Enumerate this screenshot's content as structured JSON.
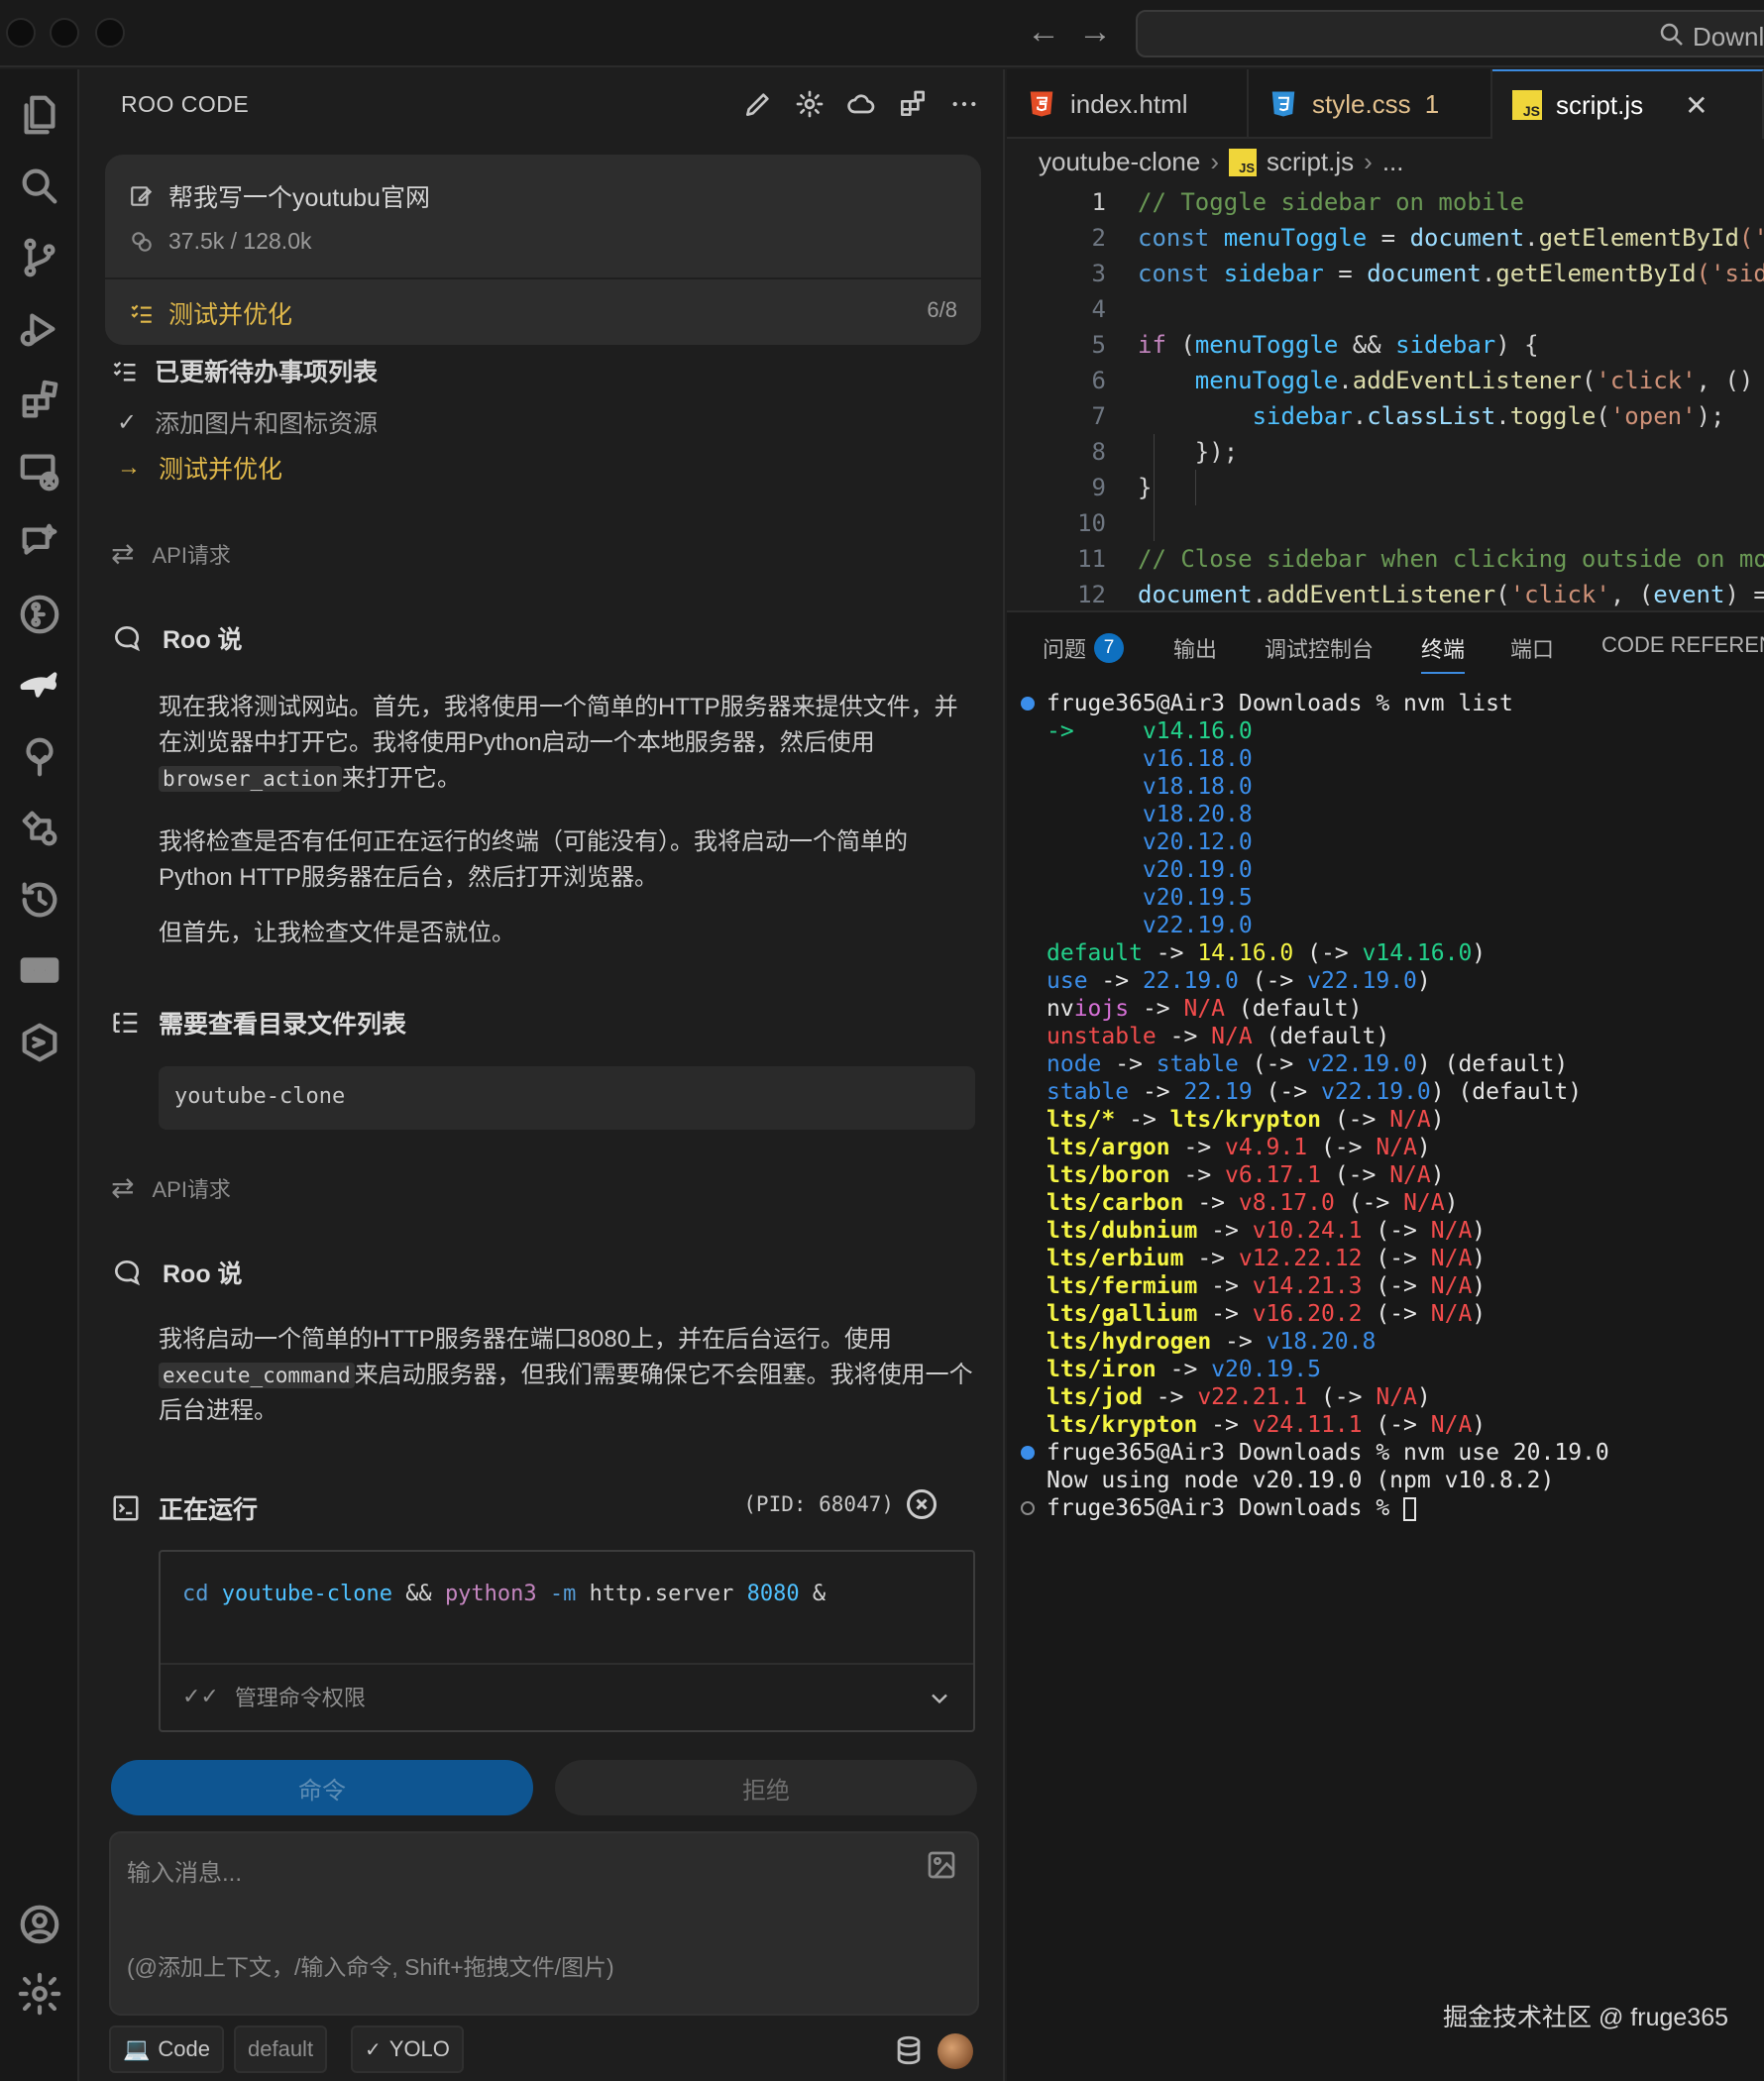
{
  "colors": {
    "accent": "#3c8be0",
    "todo_active": "#e0b84a",
    "term_green": "#23d18b",
    "term_blue": "#3b8eea",
    "term_red": "#f14c4c",
    "term_yellow": "#f5f543"
  },
  "titlebar": {
    "back_icon": "arrow-left-icon",
    "forward_icon": "arrow-right-icon",
    "search_label": "Downl"
  },
  "activity_bar": [
    "files-icon",
    "search-icon",
    "source-control-icon",
    "run-debug-icon",
    "extensions-icon",
    "remote-icon",
    "chat-icon",
    "timeline-icon",
    "roo-kangaroo-icon",
    "tree-icon",
    "flow-icon",
    "history-icon",
    "chat-box-icon",
    "hexagon-icon",
    "account-icon",
    "settings-gear-icon"
  ],
  "sidebar": {
    "title": "ROO CODE",
    "actions": [
      "pencil-icon",
      "gear-icon",
      "cloud-icon",
      "extensions-icon",
      "more-icon"
    ],
    "task": {
      "title": "帮我写一个youtubu官网",
      "tokens": "37.5k / 128.0k",
      "current_todo": "测试并优化",
      "progress": "6/8"
    },
    "todo": {
      "title": "已更新待办事项列表",
      "items": [
        {
          "label": "添加图片和图标资源",
          "status": "done"
        },
        {
          "label": "测试并优化",
          "status": "in_progress"
        }
      ]
    },
    "api_req_label": "API请求",
    "roo_says_label": "Roo 说",
    "msg1": {
      "p1a": "现在我将测试网站。首先，我将使用一个简单的HTTP服务器来提供文件，并在浏览器中打开它。我将使用Python启动一个本地服务器，然后使用",
      "p1code": "browser_action",
      "p1b": "来打开它。",
      "p2": "我将检查是否有任何正在运行的终端（可能没有）。我将启动一个简单的Python HTTP服务器在后台，然后打开浏览器。",
      "p3": "但首先，让我检查文件是否就位。"
    },
    "list_files": {
      "title": "需要查看目录文件列表",
      "dir": "youtube-clone"
    },
    "msg2": {
      "p1a": "我将启动一个简单的HTTP服务器在端口8080上，并在后台运行。使用",
      "p1code": "execute_command",
      "p1b": "来启动服务器，但我们需要确保它不会阻塞。我将使用一个后台进程。"
    },
    "running": {
      "title": "正在运行",
      "pid": "(PID: 68047)",
      "cmd": {
        "cd": "cd",
        "dir": "youtube-clone",
        "amp": "&&",
        "py": "python3",
        "flag": "-m",
        "mod": "http.server",
        "port": "8080",
        "bg": "&"
      },
      "perm_label": "管理命令权限"
    },
    "buttons": {
      "primary": "命令",
      "secondary": "拒绝"
    },
    "input": {
      "placeholder1": "输入消息...",
      "placeholder2": "(@添加上下文，/输入命令, Shift+拖拽文件/图片)"
    },
    "bottom": {
      "mode": "Code",
      "profile": "default",
      "yolo": "YOLO"
    }
  },
  "editor": {
    "tabs": [
      {
        "label": "index.html",
        "icon": "html5-icon"
      },
      {
        "label": "style.css",
        "icon": "css3-icon",
        "badge": "1"
      },
      {
        "label": "script.js",
        "icon": "js-icon",
        "active": true
      }
    ],
    "breadcrumb": {
      "folder": "youtube-clone",
      "file": "script.js",
      "more": "..."
    },
    "lines": [
      {
        "n": "1",
        "s": [
          {
            "t": "// Toggle sidebar on mobile",
            "c": "#6a9955"
          }
        ]
      },
      {
        "n": "2",
        "s": [
          {
            "t": "const ",
            "c": "#569cd6"
          },
          {
            "t": "menuToggle",
            "c": "#4fc1ff"
          },
          {
            "t": " = ",
            "c": "#d4d4d4"
          },
          {
            "t": "document",
            "c": "#9cdcfe"
          },
          {
            "t": ".",
            "c": "#d4d4d4"
          },
          {
            "t": "getElementById",
            "c": "#dcdcaa"
          },
          {
            "t": "('",
            "c": "#ce9178"
          }
        ]
      },
      {
        "n": "3",
        "s": [
          {
            "t": "const ",
            "c": "#569cd6"
          },
          {
            "t": "sidebar",
            "c": "#4fc1ff"
          },
          {
            "t": " = ",
            "c": "#d4d4d4"
          },
          {
            "t": "document",
            "c": "#9cdcfe"
          },
          {
            "t": ".",
            "c": "#d4d4d4"
          },
          {
            "t": "getElementById",
            "c": "#dcdcaa"
          },
          {
            "t": "('sid",
            "c": "#ce9178"
          }
        ]
      },
      {
        "n": "4",
        "s": []
      },
      {
        "n": "5",
        "s": [
          {
            "t": "if ",
            "c": "#c586c0"
          },
          {
            "t": "(",
            "c": "#d4d4d4"
          },
          {
            "t": "menuToggle",
            "c": "#4fc1ff"
          },
          {
            "t": " && ",
            "c": "#d4d4d4"
          },
          {
            "t": "sidebar",
            "c": "#4fc1ff"
          },
          {
            "t": ") {",
            "c": "#d4d4d4"
          }
        ]
      },
      {
        "n": "6",
        "s": [
          {
            "t": "    ",
            "c": "#d4d4d4"
          },
          {
            "t": "menuToggle",
            "c": "#4fc1ff"
          },
          {
            "t": ".",
            "c": "#d4d4d4"
          },
          {
            "t": "addEventListener",
            "c": "#dcdcaa"
          },
          {
            "t": "(",
            "c": "#d4d4d4"
          },
          {
            "t": "'click'",
            "c": "#ce9178"
          },
          {
            "t": ", ()",
            "c": "#d4d4d4"
          }
        ]
      },
      {
        "n": "7",
        "s": [
          {
            "t": "        ",
            "c": "#d4d4d4"
          },
          {
            "t": "sidebar",
            "c": "#4fc1ff"
          },
          {
            "t": ".",
            "c": "#d4d4d4"
          },
          {
            "t": "classList",
            "c": "#9cdcfe"
          },
          {
            "t": ".",
            "c": "#d4d4d4"
          },
          {
            "t": "toggle",
            "c": "#dcdcaa"
          },
          {
            "t": "(",
            "c": "#d4d4d4"
          },
          {
            "t": "'open'",
            "c": "#ce9178"
          },
          {
            "t": ");",
            "c": "#d4d4d4"
          }
        ]
      },
      {
        "n": "8",
        "s": [
          {
            "t": "    });",
            "c": "#d4d4d4"
          }
        ]
      },
      {
        "n": "9",
        "s": [
          {
            "t": "}",
            "c": "#d4d4d4"
          }
        ]
      },
      {
        "n": "10",
        "s": []
      },
      {
        "n": "11",
        "s": [
          {
            "t": "// Close sidebar when clicking outside on mo",
            "c": "#6a9955"
          }
        ]
      },
      {
        "n": "12",
        "s": [
          {
            "t": "document",
            "c": "#9cdcfe"
          },
          {
            "t": ".",
            "c": "#d4d4d4"
          },
          {
            "t": "addEventListener",
            "c": "#dcdcaa"
          },
          {
            "t": "(",
            "c": "#d4d4d4"
          },
          {
            "t": "'click'",
            "c": "#ce9178"
          },
          {
            "t": ", (",
            "c": "#d4d4d4"
          },
          {
            "t": "event",
            "c": "#9cdcfe"
          },
          {
            "t": ") =",
            "c": "#d4d4d4"
          }
        ]
      }
    ]
  },
  "panel": {
    "tabs": [
      {
        "label": "问题",
        "badge": "7"
      },
      {
        "label": "输出"
      },
      {
        "label": "调试控制台"
      },
      {
        "label": "终端",
        "active": true
      },
      {
        "label": "端口"
      },
      {
        "label": "CODE REFEREN"
      }
    ],
    "terminal": [
      {
        "dot": "#3b8eea",
        "s": [
          {
            "t": "fruge365@Air3 Downloads % nvm list",
            "c": "#e5e5e5"
          }
        ]
      },
      {
        "s": [
          {
            "t": "->     ",
            "c": "#23d18b"
          },
          {
            "t": "v14.16.0",
            "c": "#23d18b"
          }
        ]
      },
      {
        "s": [
          {
            "t": "       v16.18.0",
            "c": "#3b8eea"
          }
        ]
      },
      {
        "s": [
          {
            "t": "       v18.18.0",
            "c": "#3b8eea"
          }
        ]
      },
      {
        "s": [
          {
            "t": "       v18.20.8",
            "c": "#3b8eea"
          }
        ]
      },
      {
        "s": [
          {
            "t": "       v20.12.0",
            "c": "#3b8eea"
          }
        ]
      },
      {
        "s": [
          {
            "t": "       v20.19.0",
            "c": "#3b8eea"
          }
        ]
      },
      {
        "s": [
          {
            "t": "       v20.19.5",
            "c": "#3b8eea"
          }
        ]
      },
      {
        "s": [
          {
            "t": "       v22.19.0",
            "c": "#3b8eea"
          }
        ]
      },
      {
        "s": [
          {
            "t": "default",
            "c": "#23d18b"
          },
          {
            "t": " -> ",
            "c": "#e5e5e5"
          },
          {
            "t": "14.16.0",
            "c": "#f5f543"
          },
          {
            "t": " (-> ",
            "c": "#e5e5e5"
          },
          {
            "t": "v14.16.0",
            "c": "#23d18b"
          },
          {
            "t": ")",
            "c": "#e5e5e5"
          }
        ]
      },
      {
        "s": [
          {
            "t": "use",
            "c": "#3b8eea"
          },
          {
            "t": " -> ",
            "c": "#e5e5e5"
          },
          {
            "t": "22.19.0",
            "c": "#3b8eea"
          },
          {
            "t": " (-> ",
            "c": "#e5e5e5"
          },
          {
            "t": "v22.19.0",
            "c": "#3b8eea"
          },
          {
            "t": ")",
            "c": "#e5e5e5"
          }
        ]
      },
      {
        "s": [
          {
            "t": "nv",
            "c": "#e5e5e5"
          },
          {
            "t": "iojs",
            "c": "#d670d6"
          },
          {
            "t": " -> ",
            "c": "#e5e5e5"
          },
          {
            "t": "N/A",
            "c": "#f14c4c"
          },
          {
            "t": " (default)",
            "c": "#e5e5e5"
          }
        ]
      },
      {
        "s": [
          {
            "t": "unstable",
            "c": "#f14c4c"
          },
          {
            "t": " -> ",
            "c": "#e5e5e5"
          },
          {
            "t": "N/A",
            "c": "#f14c4c"
          },
          {
            "t": " (default)",
            "c": "#e5e5e5"
          }
        ]
      },
      {
        "s": [
          {
            "t": "node",
            "c": "#3b8eea"
          },
          {
            "t": " -> ",
            "c": "#e5e5e5"
          },
          {
            "t": "stable",
            "c": "#3b8eea"
          },
          {
            "t": " (-> ",
            "c": "#e5e5e5"
          },
          {
            "t": "v22.19.0",
            "c": "#3b8eea"
          },
          {
            "t": ") (default)",
            "c": "#e5e5e5"
          }
        ]
      },
      {
        "s": [
          {
            "t": "stable",
            "c": "#3b8eea"
          },
          {
            "t": " -> ",
            "c": "#e5e5e5"
          },
          {
            "t": "22.19",
            "c": "#3b8eea"
          },
          {
            "t": " (-> ",
            "c": "#e5e5e5"
          },
          {
            "t": "v22.19.0",
            "c": "#3b8eea"
          },
          {
            "t": ") (default)",
            "c": "#e5e5e5"
          }
        ]
      },
      {
        "s": [
          {
            "t": "lts/*",
            "c": "#f5f543",
            "b": true
          },
          {
            "t": " -> ",
            "c": "#e5e5e5"
          },
          {
            "t": "lts/krypton",
            "c": "#f5f543",
            "b": true
          },
          {
            "t": " (-> ",
            "c": "#e5e5e5"
          },
          {
            "t": "N/A",
            "c": "#f14c4c"
          },
          {
            "t": ")",
            "c": "#e5e5e5"
          }
        ]
      },
      {
        "s": [
          {
            "t": "lts/argon",
            "c": "#f5f543",
            "b": true
          },
          {
            "t": " -> ",
            "c": "#e5e5e5"
          },
          {
            "t": "v4.9.1",
            "c": "#f14c4c"
          },
          {
            "t": " (-> ",
            "c": "#e5e5e5"
          },
          {
            "t": "N/A",
            "c": "#f14c4c"
          },
          {
            "t": ")",
            "c": "#e5e5e5"
          }
        ]
      },
      {
        "s": [
          {
            "t": "lts/boron",
            "c": "#f5f543",
            "b": true
          },
          {
            "t": " -> ",
            "c": "#e5e5e5"
          },
          {
            "t": "v6.17.1",
            "c": "#f14c4c"
          },
          {
            "t": " (-> ",
            "c": "#e5e5e5"
          },
          {
            "t": "N/A",
            "c": "#f14c4c"
          },
          {
            "t": ")",
            "c": "#e5e5e5"
          }
        ]
      },
      {
        "s": [
          {
            "t": "lts/carbon",
            "c": "#f5f543",
            "b": true
          },
          {
            "t": " -> ",
            "c": "#e5e5e5"
          },
          {
            "t": "v8.17.0",
            "c": "#f14c4c"
          },
          {
            "t": " (-> ",
            "c": "#e5e5e5"
          },
          {
            "t": "N/A",
            "c": "#f14c4c"
          },
          {
            "t": ")",
            "c": "#e5e5e5"
          }
        ]
      },
      {
        "s": [
          {
            "t": "lts/dubnium",
            "c": "#f5f543",
            "b": true
          },
          {
            "t": " -> ",
            "c": "#e5e5e5"
          },
          {
            "t": "v10.24.1",
            "c": "#f14c4c"
          },
          {
            "t": " (-> ",
            "c": "#e5e5e5"
          },
          {
            "t": "N/A",
            "c": "#f14c4c"
          },
          {
            "t": ")",
            "c": "#e5e5e5"
          }
        ]
      },
      {
        "s": [
          {
            "t": "lts/erbium",
            "c": "#f5f543",
            "b": true
          },
          {
            "t": " -> ",
            "c": "#e5e5e5"
          },
          {
            "t": "v12.22.12",
            "c": "#f14c4c"
          },
          {
            "t": " (-> ",
            "c": "#e5e5e5"
          },
          {
            "t": "N/A",
            "c": "#f14c4c"
          },
          {
            "t": ")",
            "c": "#e5e5e5"
          }
        ]
      },
      {
        "s": [
          {
            "t": "lts/fermium",
            "c": "#f5f543",
            "b": true
          },
          {
            "t": " -> ",
            "c": "#e5e5e5"
          },
          {
            "t": "v14.21.3",
            "c": "#f14c4c"
          },
          {
            "t": " (-> ",
            "c": "#e5e5e5"
          },
          {
            "t": "N/A",
            "c": "#f14c4c"
          },
          {
            "t": ")",
            "c": "#e5e5e5"
          }
        ]
      },
      {
        "s": [
          {
            "t": "lts/gallium",
            "c": "#f5f543",
            "b": true
          },
          {
            "t": " -> ",
            "c": "#e5e5e5"
          },
          {
            "t": "v16.20.2",
            "c": "#f14c4c"
          },
          {
            "t": " (-> ",
            "c": "#e5e5e5"
          },
          {
            "t": "N/A",
            "c": "#f14c4c"
          },
          {
            "t": ")",
            "c": "#e5e5e5"
          }
        ]
      },
      {
        "s": [
          {
            "t": "lts/hydrogen",
            "c": "#f5f543",
            "b": true
          },
          {
            "t": " -> ",
            "c": "#e5e5e5"
          },
          {
            "t": "v18.20.8",
            "c": "#3b8eea"
          }
        ]
      },
      {
        "s": [
          {
            "t": "lts/iron",
            "c": "#f5f543",
            "b": true
          },
          {
            "t": " -> ",
            "c": "#e5e5e5"
          },
          {
            "t": "v20.19.5",
            "c": "#3b8eea"
          }
        ]
      },
      {
        "s": [
          {
            "t": "lts/jod",
            "c": "#f5f543",
            "b": true
          },
          {
            "t": " -> ",
            "c": "#e5e5e5"
          },
          {
            "t": "v22.21.1",
            "c": "#f14c4c"
          },
          {
            "t": " (-> ",
            "c": "#e5e5e5"
          },
          {
            "t": "N/A",
            "c": "#f14c4c"
          },
          {
            "t": ")",
            "c": "#e5e5e5"
          }
        ]
      },
      {
        "s": [
          {
            "t": "lts/krypton",
            "c": "#f5f543",
            "b": true
          },
          {
            "t": " -> ",
            "c": "#e5e5e5"
          },
          {
            "t": "v24.11.1",
            "c": "#f14c4c"
          },
          {
            "t": " (-> ",
            "c": "#e5e5e5"
          },
          {
            "t": "N/A",
            "c": "#f14c4c"
          },
          {
            "t": ")",
            "c": "#e5e5e5"
          }
        ]
      },
      {
        "dot": "#3b8eea",
        "s": [
          {
            "t": "fruge365@Air3 Downloads % nvm use 20.19.0",
            "c": "#e5e5e5"
          }
        ]
      },
      {
        "s": [
          {
            "t": "Now using node v20.19.0 (npm v10.8.2)",
            "c": "#e5e5e5"
          }
        ]
      },
      {
        "dot": "hollow",
        "cursor": true,
        "s": [
          {
            "t": "fruge365@Air3 Downloads % ",
            "c": "#e5e5e5"
          }
        ]
      }
    ]
  },
  "watermark": "掘金技术社区 @ fruge365"
}
